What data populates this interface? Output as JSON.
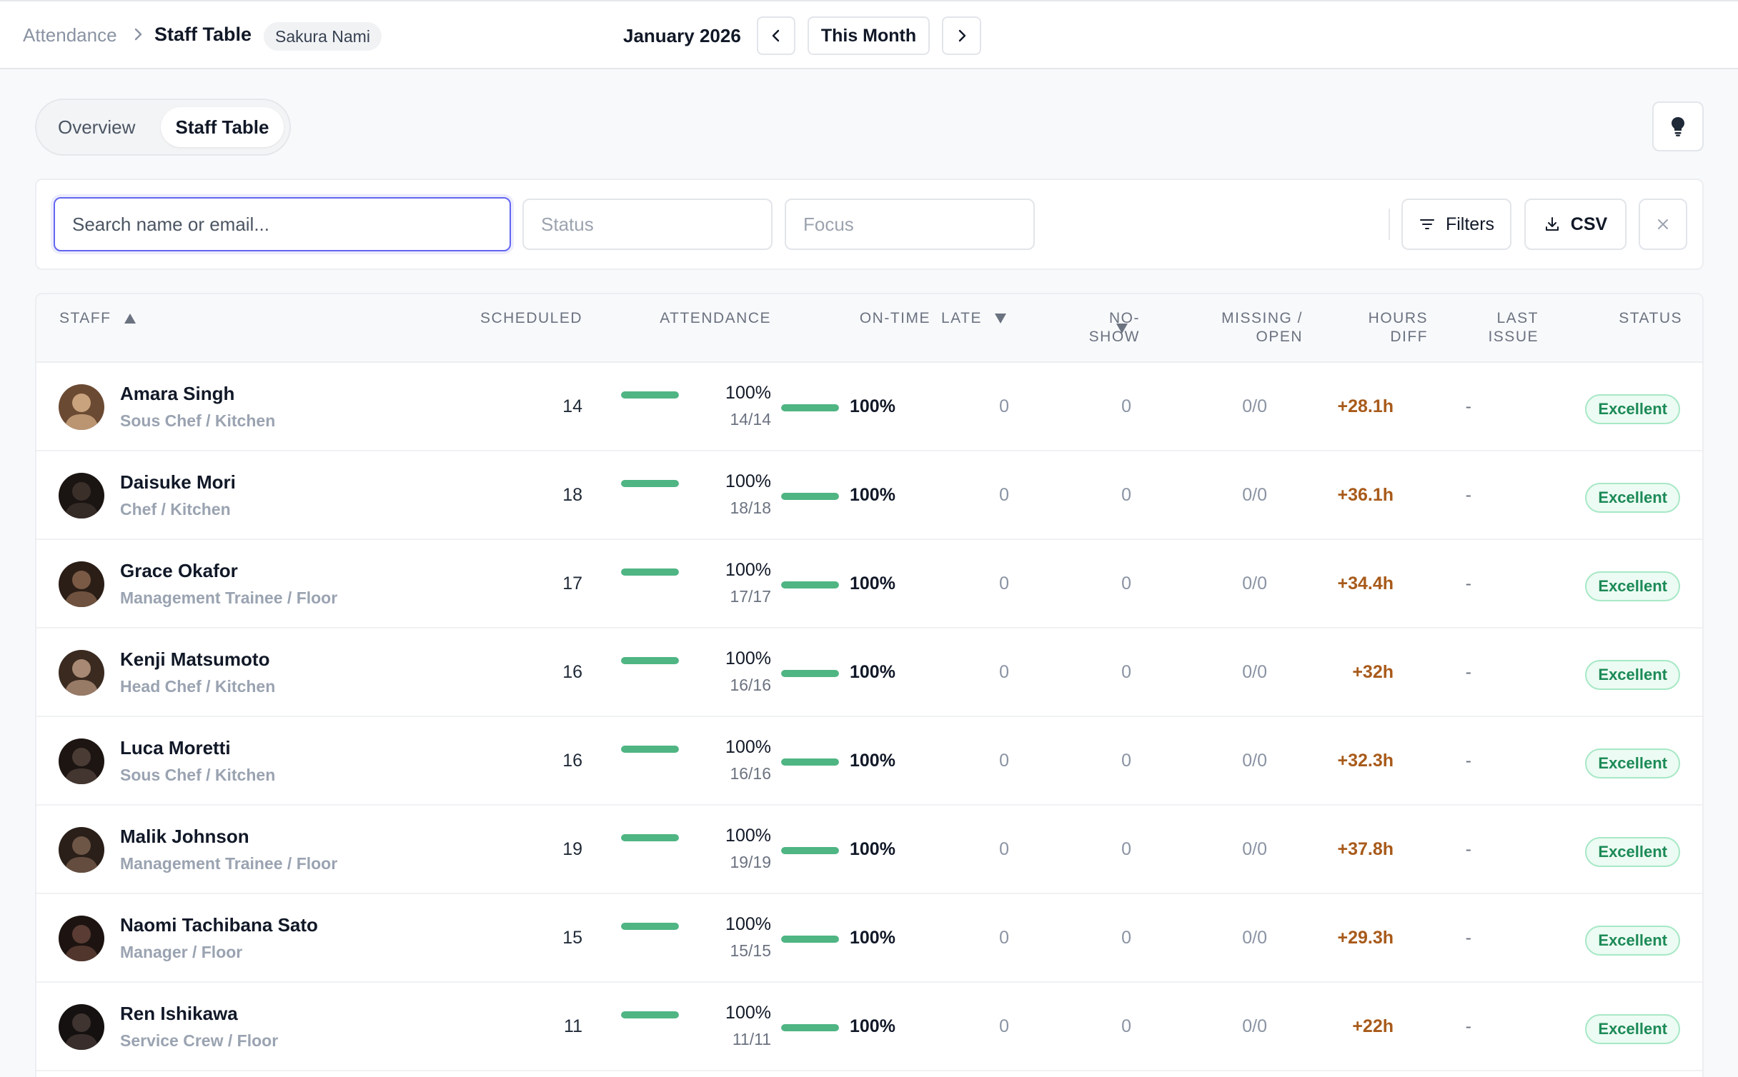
{
  "breadcrumb": {
    "root": "Attendance",
    "current": "Staff Table",
    "user": "Sakura Nami"
  },
  "period": {
    "label": "January 2026",
    "this_month": "This Month"
  },
  "tabs": [
    {
      "label": "Overview"
    },
    {
      "label": "Staff Table"
    }
  ],
  "filters": {
    "search_placeholder": "Search name or email...",
    "status_placeholder": "Status",
    "focus_placeholder": "Focus",
    "filters_label": "Filters",
    "csv_label": "CSV"
  },
  "table": {
    "headers": {
      "staff": "STAFF",
      "scheduled": "SCHEDULED",
      "attendance": "ATTENDANCE",
      "ontime": "ON-TIME",
      "late": "LATE",
      "noshow_1": "NO-",
      "noshow_2": "SHOW",
      "missing_1": "MISSING /",
      "missing_2": "OPEN",
      "hours_1": "HOURS",
      "hours_2": "DIFF",
      "last_1": "LAST",
      "last_2": "ISSUE",
      "status": "STATUS"
    },
    "rows": [
      {
        "name": "Amara Singh",
        "role": "Sous Chef / Kitchen",
        "scheduled": "14",
        "attendance_pct": "100%",
        "attendance_frac": "14/14",
        "attendance_value": 1.0,
        "ontime_pct": "100%",
        "ontime_value": 1.0,
        "late": "0",
        "noshow": "0",
        "missing": "0/0",
        "hours_diff": "+28.1h",
        "last_issue": "-",
        "status": "Excellent"
      },
      {
        "name": "Daisuke Mori",
        "role": "Chef / Kitchen",
        "scheduled": "18",
        "attendance_pct": "100%",
        "attendance_frac": "18/18",
        "attendance_value": 1.0,
        "ontime_pct": "100%",
        "ontime_value": 1.0,
        "late": "0",
        "noshow": "0",
        "missing": "0/0",
        "hours_diff": "+36.1h",
        "last_issue": "-",
        "status": "Excellent"
      },
      {
        "name": "Grace Okafor",
        "role": "Management Trainee / Floor",
        "scheduled": "17",
        "attendance_pct": "100%",
        "attendance_frac": "17/17",
        "attendance_value": 1.0,
        "ontime_pct": "100%",
        "ontime_value": 1.0,
        "late": "0",
        "noshow": "0",
        "missing": "0/0",
        "hours_diff": "+34.4h",
        "last_issue": "-",
        "status": "Excellent"
      },
      {
        "name": "Kenji Matsumoto",
        "role": "Head Chef / Kitchen",
        "scheduled": "16",
        "attendance_pct": "100%",
        "attendance_frac": "16/16",
        "attendance_value": 1.0,
        "ontime_pct": "100%",
        "ontime_value": 1.0,
        "late": "0",
        "noshow": "0",
        "missing": "0/0",
        "hours_diff": "+32h",
        "last_issue": "-",
        "status": "Excellent"
      },
      {
        "name": "Luca Moretti",
        "role": "Sous Chef / Kitchen",
        "scheduled": "16",
        "attendance_pct": "100%",
        "attendance_frac": "16/16",
        "attendance_value": 1.0,
        "ontime_pct": "100%",
        "ontime_value": 1.0,
        "late": "0",
        "noshow": "0",
        "missing": "0/0",
        "hours_diff": "+32.3h",
        "last_issue": "-",
        "status": "Excellent"
      },
      {
        "name": "Malik Johnson",
        "role": "Management Trainee / Floor",
        "scheduled": "19",
        "attendance_pct": "100%",
        "attendance_frac": "19/19",
        "attendance_value": 1.0,
        "ontime_pct": "100%",
        "ontime_value": 1.0,
        "late": "0",
        "noshow": "0",
        "missing": "0/0",
        "hours_diff": "+37.8h",
        "last_issue": "-",
        "status": "Excellent"
      },
      {
        "name": "Naomi Tachibana Sato",
        "role": "Manager / Floor",
        "scheduled": "15",
        "attendance_pct": "100%",
        "attendance_frac": "15/15",
        "attendance_value": 1.0,
        "ontime_pct": "100%",
        "ontime_value": 1.0,
        "late": "0",
        "noshow": "0",
        "missing": "0/0",
        "hours_diff": "+29.3h",
        "last_issue": "-",
        "status": "Excellent"
      },
      {
        "name": "Ren Ishikawa",
        "role": "Service Crew / Floor",
        "scheduled": "11",
        "attendance_pct": "100%",
        "attendance_frac": "11/11",
        "attendance_value": 1.0,
        "ontime_pct": "100%",
        "ontime_value": 1.0,
        "late": "0",
        "noshow": "0",
        "missing": "0/0",
        "hours_diff": "+22h",
        "last_issue": "-",
        "status": "Excellent"
      }
    ]
  },
  "icons": {
    "breadcrumb_separator": "chevron-right-icon",
    "prev": "chevron-left-icon",
    "next": "chevron-right-icon",
    "hint": "lightbulb-icon",
    "filters": "filter-lines-icon",
    "csv": "download-icon",
    "clear": "close-icon",
    "sort_asc": "sort-up-icon",
    "sort_desc": "sort-down-icon",
    "avatar": "avatar-photo"
  },
  "colors": {
    "accent": "#6366f1",
    "progress": "#4fb583",
    "hours_positive": "#a85a1a",
    "status_excellent_text": "#1c8a57",
    "status_excellent_bg": "#ecfbf3"
  }
}
